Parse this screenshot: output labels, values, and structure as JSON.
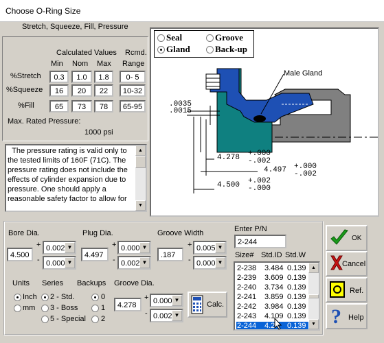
{
  "window": {
    "title": "Choose O-Ring Size"
  },
  "header": {
    "subtitle": "Stretch, Squeeze, Fill, Pressure"
  },
  "values_table": {
    "calc_header": "Calculated Values",
    "rcmd_header": "Rcmd.",
    "col_min": "Min",
    "col_nom": "Nom",
    "col_max": "Max",
    "col_range": "Range",
    "rows": [
      {
        "label": "%Stretch",
        "min": "0.3",
        "nom": "1.0",
        "max": "1.8",
        "range": "0- 5"
      },
      {
        "label": "%Squeeze",
        "min": "16",
        "nom": "20",
        "max": "22",
        "range": "10-32"
      },
      {
        "label": "%Fill",
        "min": "65",
        "nom": "73",
        "max": "78",
        "range": "65-95"
      }
    ]
  },
  "pressure": {
    "label": "Max. Rated Pressure:",
    "value": "1000 psi"
  },
  "note": "  The pressure rating is valid only to the tested limits of 160F (71C). The pressure rating does not include the effects of cylinder expansion due to pressure. One should apply a reasonable safety factor to allow for",
  "gland_type": {
    "seal": "Seal",
    "gland": "Gland",
    "groove": "Groove",
    "backup": "Back-up",
    "selected": "gland"
  },
  "diagram": {
    "label": "Male Gland",
    "dim_top1": ".0035",
    "dim_top2": ".0015",
    "dim1_val": "4.278",
    "dim1_plus": "+.000",
    "dim1_minus": "-.002",
    "dim2_val": "4.497",
    "dim2_plus": "+.000",
    "dim2_minus": "-.002",
    "dim3_val": "4.500",
    "dim3_plus": "+.002",
    "dim3_minus": "-.000"
  },
  "inputs": {
    "bore_label": "Bore Dia.",
    "bore_value": "4.500",
    "bore_plus": "0.002",
    "bore_minus": "0.000",
    "plug_label": "Plug Dia.",
    "plug_value": "4.497",
    "plug_plus": "0.000",
    "plug_minus": "0.002",
    "groove_width_label": "Groove Width",
    "groove_width_value": ".187",
    "gw_plus": "0.005",
    "gw_minus": "0.000",
    "groove_dia_label": "Groove Dia.",
    "groove_dia_value": "4.278",
    "gd_plus": "0.000",
    "gd_minus": "0.002",
    "plus_sign": "+",
    "minus_sign": "-"
  },
  "units": {
    "label": "Units",
    "inch": "Inch",
    "mm": "mm",
    "selected": "inch"
  },
  "series": {
    "label": "Series",
    "opt1": "2 - Std.",
    "opt2": "3 - Boss",
    "opt3": "5 - Special",
    "selected": "2 - Std."
  },
  "backups": {
    "label": "Backups",
    "opt0": "0",
    "opt1": "1",
    "opt2": "2",
    "selected": "0"
  },
  "calc_button": "Calc.",
  "pn": {
    "label": "Enter P/N",
    "value": "2-244",
    "col_size": "Size#",
    "col_id": "Std.ID",
    "col_w": "Std.W",
    "rows": [
      {
        "size": "2-238",
        "id": "3.484",
        "w": "0.139"
      },
      {
        "size": "2-239",
        "id": "3.609",
        "w": "0.139"
      },
      {
        "size": "2-240",
        "id": "3.734",
        "w": "0.139"
      },
      {
        "size": "2-241",
        "id": "3.859",
        "w": "0.139"
      },
      {
        "size": "2-242",
        "id": "3.984",
        "w": "0.139"
      },
      {
        "size": "2-243",
        "id": "4.109",
        "w": "0.139"
      },
      {
        "size": "2-244",
        "id": "4.2",
        "w": "0.139"
      }
    ],
    "selected": "2-244"
  },
  "buttons": {
    "ok": "OK",
    "cancel": "Cancel",
    "ref": "Ref.",
    "help": "Help"
  },
  "colors": {
    "teal": "#0f8080",
    "blue": "#1e50b4",
    "gray": "#808080",
    "selection": "#0a64d7"
  }
}
